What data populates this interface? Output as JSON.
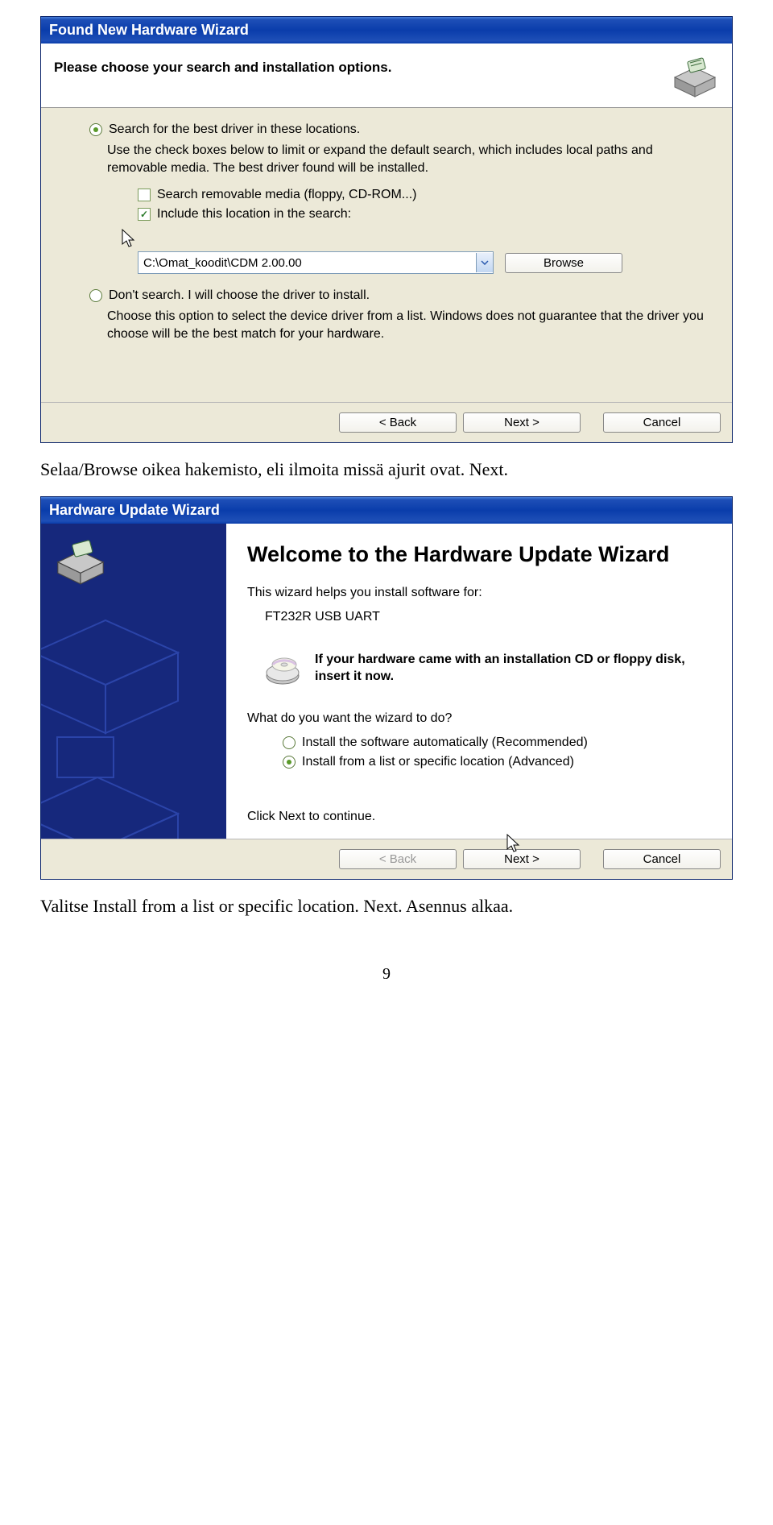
{
  "dialog1": {
    "title": "Found New Hardware Wizard",
    "header": "Please choose your search and installation options.",
    "opt1_label": "Search for the best driver in these locations.",
    "opt1_desc": "Use the check boxes below to limit or expand the default search, which includes local paths and removable media. The best driver found will be installed.",
    "chk1_label": "Search removable media (floppy, CD-ROM...)",
    "chk2_label": "Include this location in the search:",
    "path_value": "C:\\Omat_koodit\\CDM 2.00.00",
    "browse_label": "Browse",
    "opt2_label": "Don't search. I will choose the driver to install.",
    "opt2_desc": "Choose this option to select the device driver from a list.  Windows does not guarantee that the driver you choose will be the best match for your hardware.",
    "back": "< Back",
    "next": "Next >",
    "cancel": "Cancel"
  },
  "caption1": "Selaa/Browse oikea hakemisto, eli ilmoita missä ajurit ovat. Next.",
  "dialog2": {
    "title": "Hardware Update Wizard",
    "welcome": "Welcome to the Hardware Update Wizard",
    "intro": "This wizard helps you install software for:",
    "device": "FT232R USB UART",
    "cd_text": "If your hardware came with an installation CD or floppy disk, insert it now.",
    "question": "What do you want the wizard to do?",
    "optA": "Install the software automatically (Recommended)",
    "optB": "Install from a list or specific location (Advanced)",
    "click_next": "Click Next to continue.",
    "back": "< Back",
    "next": "Next >",
    "cancel": "Cancel"
  },
  "caption2": "Valitse Install from a list or specific location. Next. Asennus alkaa.",
  "pagenum": "9"
}
